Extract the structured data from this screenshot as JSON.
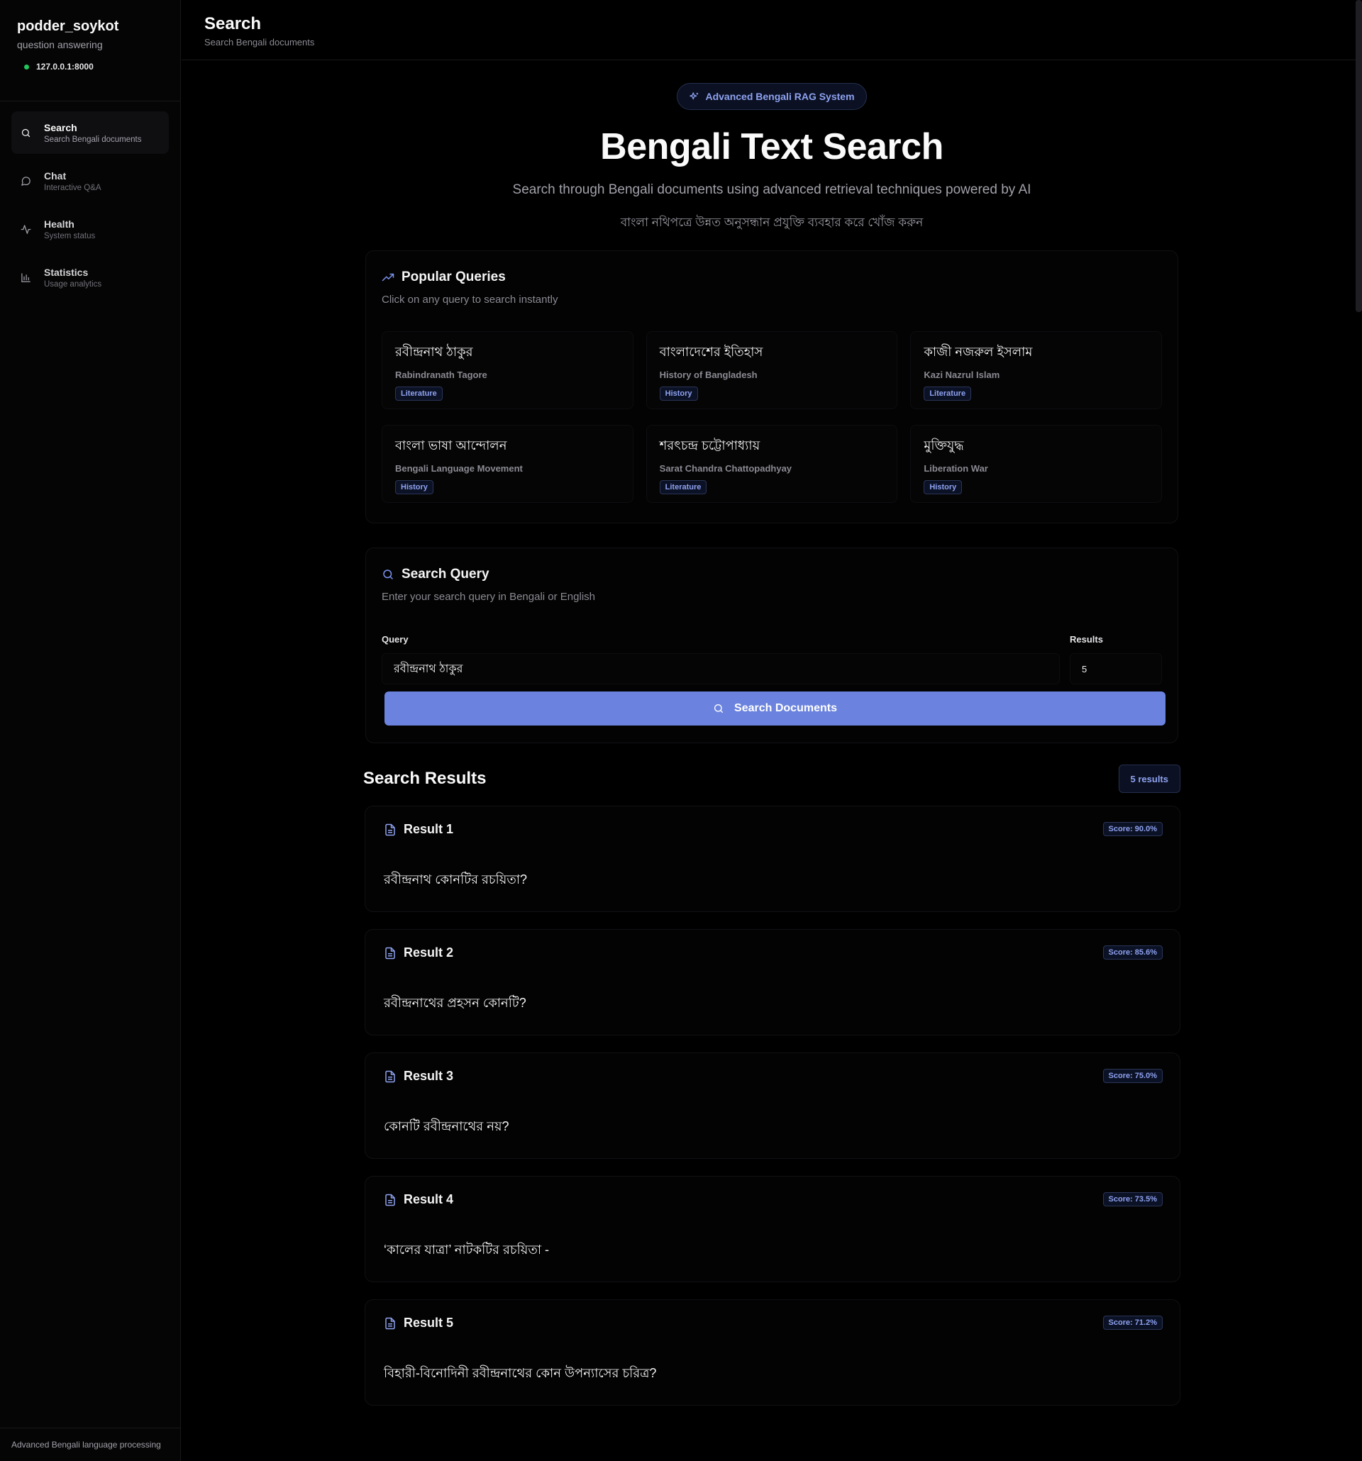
{
  "brand": {
    "name": "podder_soykot",
    "subtitle": "question answering",
    "server": "127.0.0.1:8000"
  },
  "nav": [
    {
      "title": "Search",
      "sub": "Search Bengali documents",
      "icon": "search-icon"
    },
    {
      "title": "Chat",
      "sub": "Interactive Q&A",
      "icon": "chat-icon"
    },
    {
      "title": "Health",
      "sub": "System status",
      "icon": "activity-icon"
    },
    {
      "title": "Statistics",
      "sub": "Usage analytics",
      "icon": "bar-chart-icon"
    }
  ],
  "footer": "Advanced Bengali language processing",
  "header": {
    "title": "Search",
    "subtitle": "Search Bengali documents"
  },
  "hero": {
    "pill": "Advanced Bengali RAG System",
    "title": "Bengali Text Search",
    "desc": "Search through Bengali documents using advanced retrieval techniques powered by AI",
    "desc_bn": "বাংলা নথিপত্রে উন্নত অনুসন্ধান প্রযুক্তি ব্যবহার করে খোঁজ করুন"
  },
  "popular": {
    "title": "Popular Queries",
    "desc": "Click on any query to search instantly",
    "items": [
      {
        "bn": "রবীন্দ্রনাথ ঠাকুর",
        "en": "Rabindranath Tagore",
        "tag": "Literature"
      },
      {
        "bn": "বাংলাদেশের ইতিহাস",
        "en": "History of Bangladesh",
        "tag": "History"
      },
      {
        "bn": "কাজী নজরুল ইসলাম",
        "en": "Kazi Nazrul Islam",
        "tag": "Literature"
      },
      {
        "bn": "বাংলা ভাষা আন্দোলন",
        "en": "Bengali Language Movement",
        "tag": "History"
      },
      {
        "bn": "শরৎচন্দ্র চট্টোপাধ্যায়",
        "en": "Sarat Chandra Chattopadhyay",
        "tag": "Literature"
      },
      {
        "bn": "মুক্তিযুদ্ধ",
        "en": "Liberation War",
        "tag": "History"
      }
    ]
  },
  "search": {
    "title": "Search Query",
    "desc": "Enter your search query in Bengali or English",
    "query_label": "Query",
    "query_value": "রবীন্দ্রনাথ ঠাকুর",
    "results_label": "Results",
    "results_value": "5",
    "button": "Search Documents"
  },
  "results": {
    "title": "Search Results",
    "count": "5 results",
    "items": [
      {
        "title": "Result 1",
        "score": "Score: 90.0%",
        "text": "রবীন্দ্রনাথ কোনটির রচয়িতা?"
      },
      {
        "title": "Result 2",
        "score": "Score: 85.6%",
        "text": "রবীন্দ্রনাথের প্রহসন কোনটি?"
      },
      {
        "title": "Result 3",
        "score": "Score: 75.0%",
        "text": "কোনটি রবীন্দ্রনাথের নয়?"
      },
      {
        "title": "Result 4",
        "score": "Score: 73.5%",
        "text": "‘কালের যাত্রা’ নাটকটির রচয়িতা -"
      },
      {
        "title": "Result 5",
        "score": "Score: 71.2%",
        "text": "বিহারী-বিনোদিনী রবীন্দ্রনাথের কোন উপন্যাসের চরিত্র?"
      }
    ]
  }
}
